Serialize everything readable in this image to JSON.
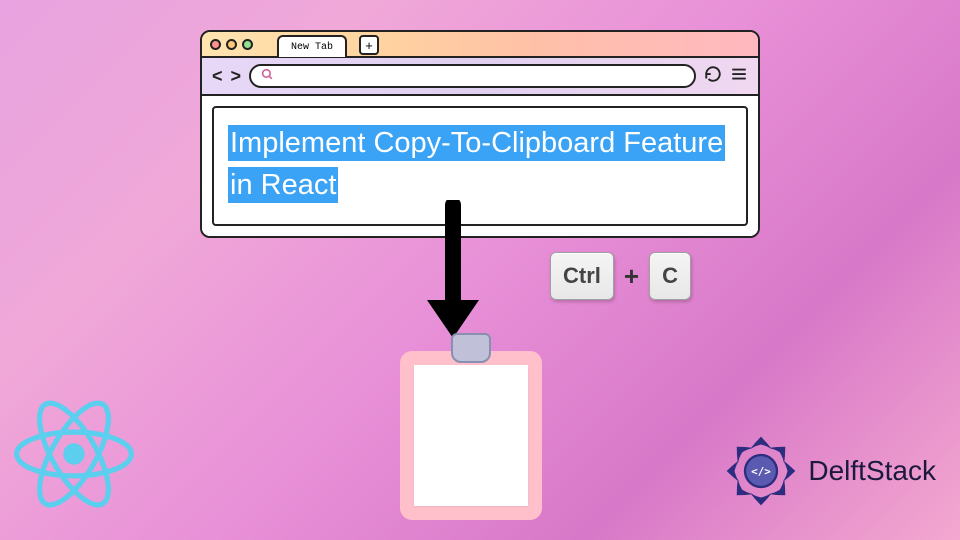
{
  "browser": {
    "tab_label": "New Tab",
    "newtab_symbol": "+",
    "nav": {
      "back": "<",
      "forward": ">"
    },
    "headline": "Implement Copy-To-Clipboard Feature in React"
  },
  "shortcut": {
    "key1": "Ctrl",
    "sep": "+",
    "key2": "C"
  },
  "brand": {
    "delftstack": "DelftStack"
  },
  "colors": {
    "highlight_bg": "#3aa3f5",
    "react_logo": "#5ccfee",
    "delft_badge": "#2d2d7f"
  }
}
